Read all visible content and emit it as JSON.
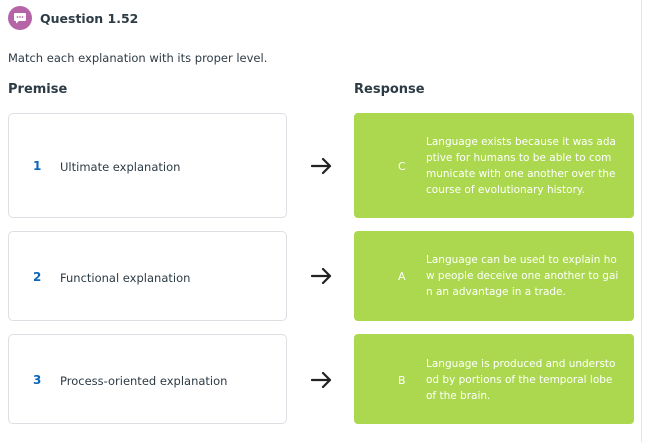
{
  "question": {
    "title": "Question 1.52",
    "instructions": "Match each explanation with its proper level."
  },
  "columns": {
    "premise": "Premise",
    "response": "Response"
  },
  "pairs": [
    {
      "number": "1",
      "premise": "Ultimate explanation",
      "letter": "C",
      "response": "Language exists because it was adaptive for humans to be able to communicate with one another over the course of evolutionary history."
    },
    {
      "number": "2",
      "premise": "Functional explanation",
      "letter": "A",
      "response": "Language can be used to explain how people deceive one another to gain an advantage in a trade."
    },
    {
      "number": "3",
      "premise": "Process-oriented explanation",
      "letter": "B",
      "response": "Language is produced and understood by portions of the temporal lobe of the brain."
    }
  ],
  "colors": {
    "icon_bg": "#b565a7",
    "number_blue": "#0a66b8",
    "response_green": "#abd84e"
  },
  "icons": {
    "question": "chat-bubble-icon",
    "arrow": "arrow-right-icon"
  }
}
